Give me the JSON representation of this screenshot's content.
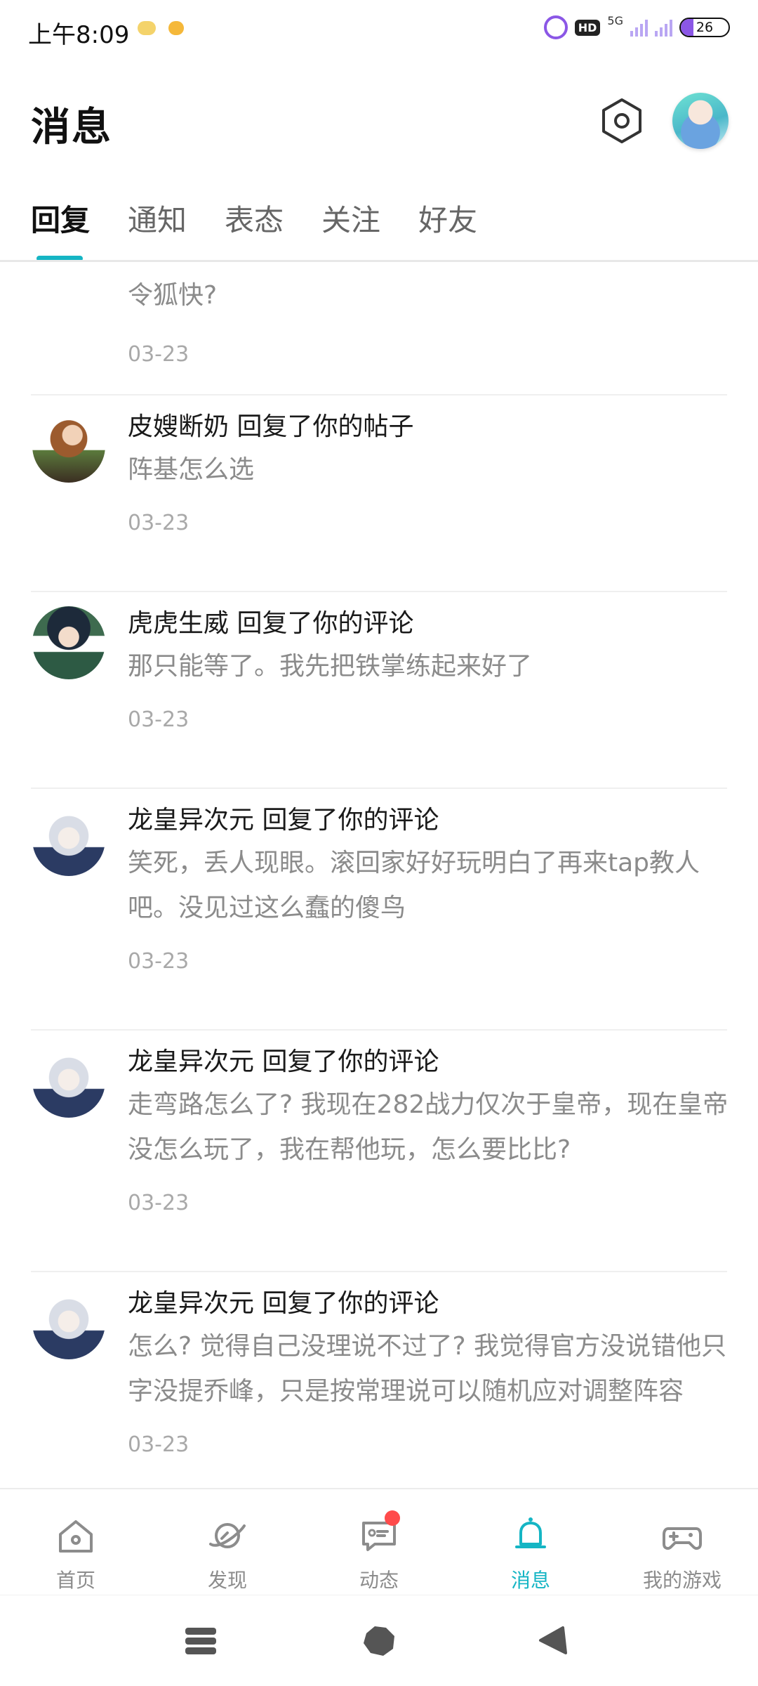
{
  "status_bar": {
    "time": "上午8:09",
    "network": "5G",
    "hd": "HD",
    "battery": "26",
    "battery_level": 0.26,
    "accent": "#8b57e6"
  },
  "header": {
    "title": "消息",
    "settings_icon": "hexagon-settings-icon",
    "avatar_icon": "user-avatar"
  },
  "tabs": [
    {
      "label": "回复",
      "active": true
    },
    {
      "label": "通知",
      "active": false
    },
    {
      "label": "表态",
      "active": false
    },
    {
      "label": "关注",
      "active": false
    },
    {
      "label": "好友",
      "active": false
    }
  ],
  "partial_item": {
    "content": "令狐快?",
    "date": "03-23"
  },
  "messages": [
    {
      "title": "皮嫂断奶 回复了你的帖子",
      "content": "阵基怎么选",
      "date": "03-23",
      "avatar": "scholar-avatar"
    },
    {
      "title": "虎虎生威 回复了你的评论",
      "content": "那只能等了。我先把铁掌练起来好了",
      "date": "03-23",
      "avatar": "bard-avatar"
    },
    {
      "title": "龙皇异次元 回复了你的评论",
      "content": "笑死，丢人现眼。滚回家好好玩明白了再来tap教人吧。没见过这么蠢的傻鸟",
      "date": "03-23",
      "avatar": "fox-avatar"
    },
    {
      "title": "龙皇异次元 回复了你的评论",
      "content": "走弯路怎么了? 我现在282战力仅次于皇帝，现在皇帝没怎么玩了，我在帮他玩，怎么要比比?",
      "date": "03-23",
      "avatar": "fox-avatar"
    },
    {
      "title": "龙皇异次元 回复了你的评论",
      "content": "怎么? 觉得自己没理说不过了? 我觉得官方没说错他只字没提乔峰，只是按常理说可以随机应对调整阵容",
      "date": "03-23",
      "avatar": "fox-avatar"
    }
  ],
  "bottom_nav": [
    {
      "label": "首页",
      "icon": "home-icon",
      "active": false
    },
    {
      "label": "发现",
      "icon": "planet-icon",
      "active": false
    },
    {
      "label": "动态",
      "icon": "chat-icon",
      "active": false,
      "badge": true
    },
    {
      "label": "消息",
      "icon": "bell-icon",
      "active": true
    },
    {
      "label": "我的游戏",
      "icon": "gamepad-icon",
      "active": false
    }
  ],
  "colors": {
    "accent": "#15b5c4",
    "badge": "#ff4b4b",
    "inactive": "#8c8c8c"
  }
}
